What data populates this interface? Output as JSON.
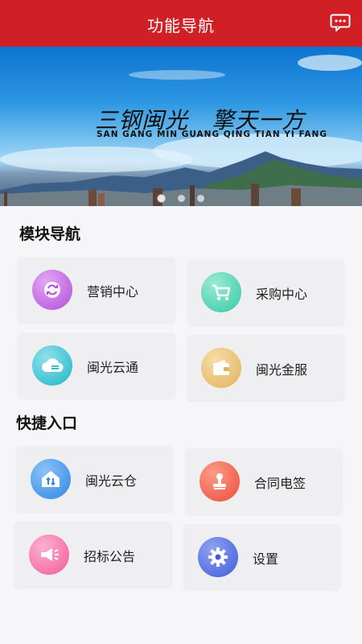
{
  "header": {
    "title": "功能导航",
    "message_icon": "message-icon"
  },
  "banner": {
    "slogan": "三钢闽光　擎天一方",
    "subtitle": "SAN GANG MIN GUANG   QING TIAN YI FANG",
    "dots": 3,
    "active_dot": 0
  },
  "sections": {
    "modules": {
      "title": "模块导航",
      "items": [
        {
          "label": "营销中心",
          "icon": "sync-icon",
          "color": "#b14fd8"
        },
        {
          "label": "采购中心",
          "icon": "cart-icon",
          "color": "#35c9a6"
        },
        {
          "label": "闽光云通",
          "icon": "cloud-icon",
          "color": "#1fb6c9"
        },
        {
          "label": "闽光金服",
          "icon": "wallet-icon",
          "color": "#e0b35c"
        }
      ]
    },
    "shortcuts": {
      "title": "快捷入口",
      "items": [
        {
          "label": "闽光云仓",
          "icon": "warehouse-icon",
          "color": "#2e86e6"
        },
        {
          "label": "合同电签",
          "icon": "stamp-icon",
          "color": "#ef4b3a"
        },
        {
          "label": "招标公告",
          "icon": "megaphone-icon",
          "color": "#f35b9a"
        },
        {
          "label": "设置",
          "icon": "gear-icon",
          "color": "#3f5cd9"
        }
      ]
    }
  }
}
